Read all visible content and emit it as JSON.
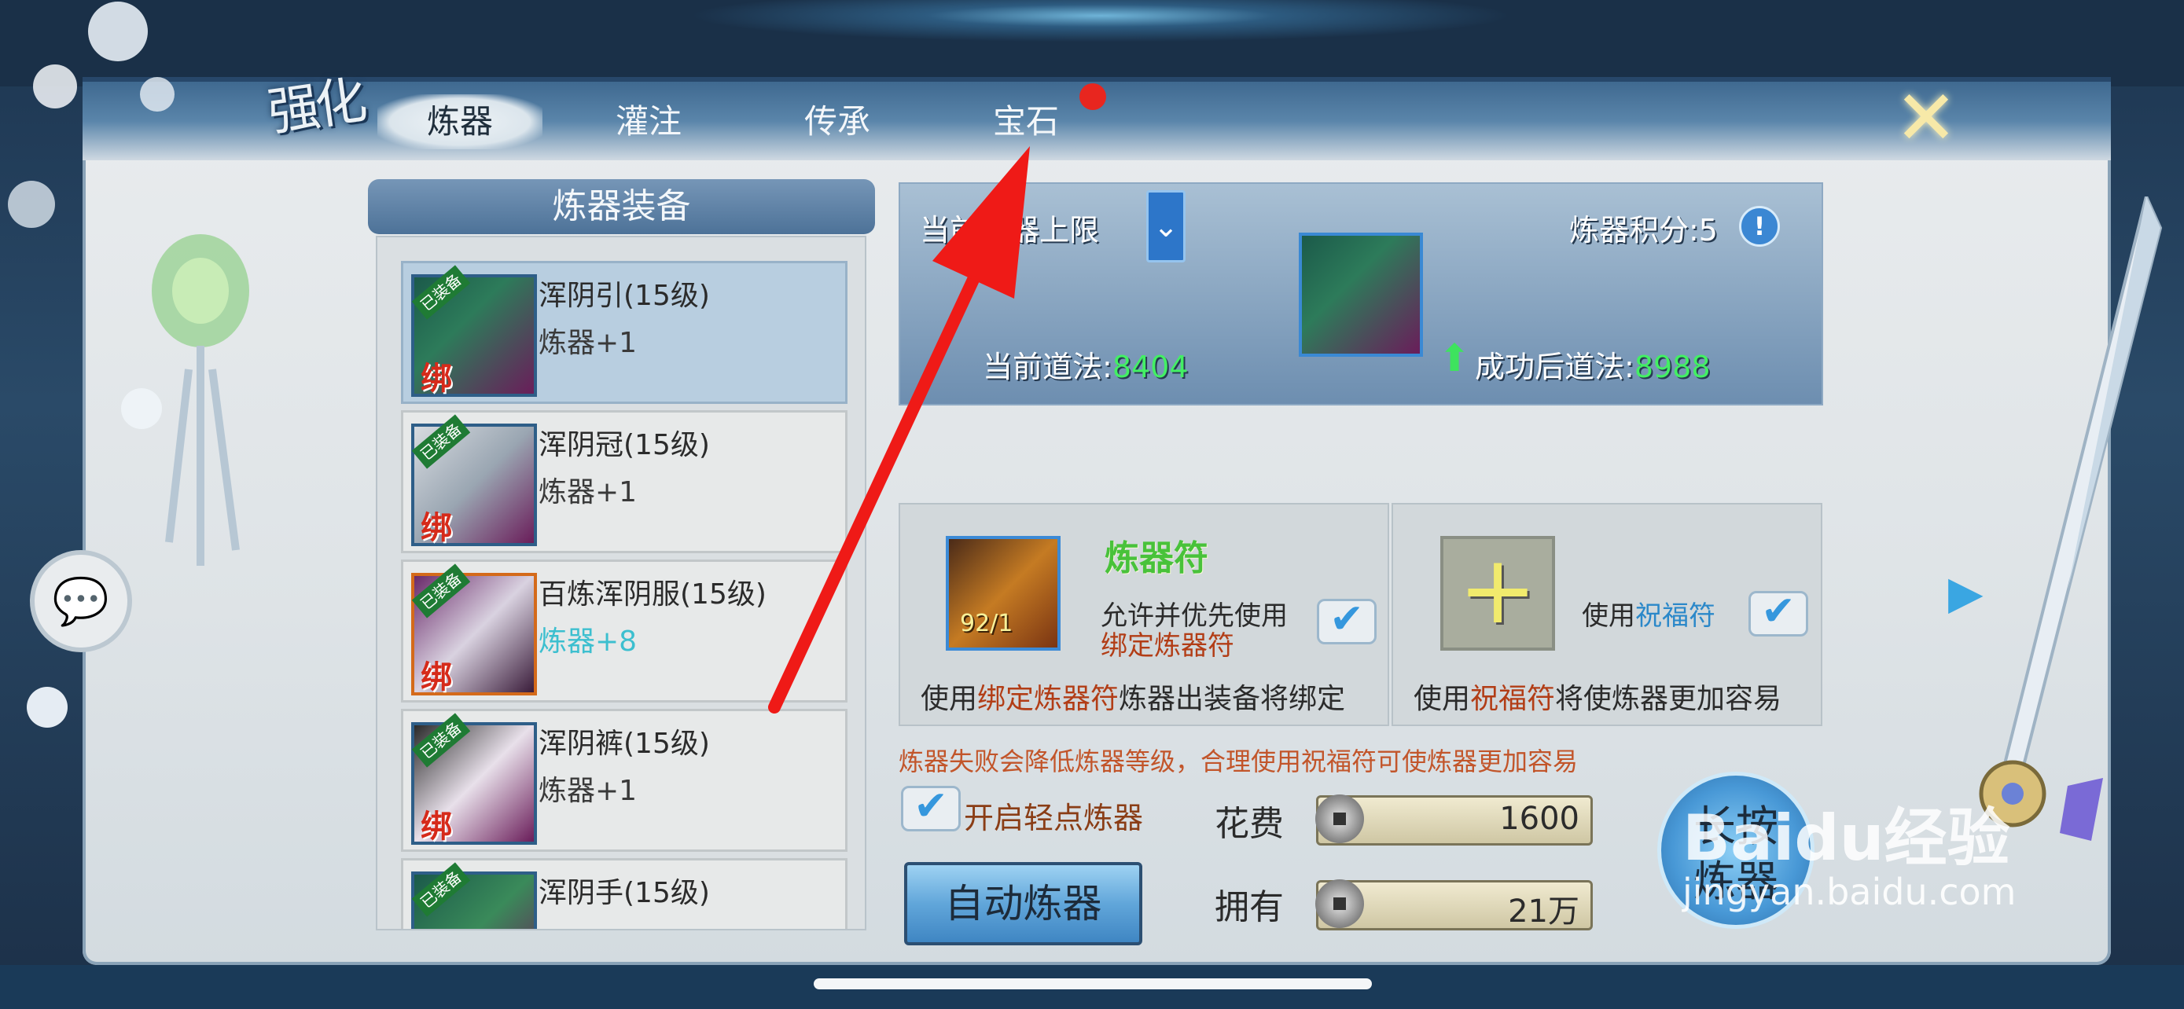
{
  "header": {
    "title_glyph": "强化",
    "tabs": [
      {
        "label": "炼器",
        "active": true
      },
      {
        "label": "灌注",
        "active": false
      },
      {
        "label": "传承",
        "active": false
      },
      {
        "label": "宝石",
        "active": false,
        "has_dot": true
      }
    ],
    "close_icon": "close-cross-icon"
  },
  "equipment_list": {
    "title": "炼器装备",
    "items": [
      {
        "name": "浑阴引(15级)",
        "level": "炼器+1",
        "tag": "已装备",
        "bind": "绑",
        "selected": true
      },
      {
        "name": "浑阴冠(15级)",
        "level": "炼器+1",
        "tag": "已装备",
        "bind": "绑",
        "selected": false
      },
      {
        "name": "百炼浑阴服(15级)",
        "level": "炼器+8",
        "tag": "已装备",
        "bind": "绑",
        "selected": false
      },
      {
        "name": "浑阴裤(15级)",
        "level": "炼器+1",
        "tag": "已装备",
        "bind": "绑",
        "selected": false
      },
      {
        "name": "浑阴手(15级)",
        "level": "",
        "tag": "已装备",
        "bind": "",
        "selected": false
      }
    ]
  },
  "info": {
    "limit_label": "当前炼器上限",
    "score_label": "炼器积分:5",
    "current_label": "当前道法:",
    "current_value": "8404",
    "after_label": "成功后道法:",
    "after_value": "8988"
  },
  "card_left": {
    "title": "炼器符",
    "count": "92/1",
    "option_line1": "允许并优先使用",
    "option_line2": "绑定炼器符",
    "bottom_pre": "使用",
    "bottom_red": "绑定炼器符",
    "bottom_post": "炼器出装备将绑定"
  },
  "card_right": {
    "option_pre": "使用",
    "option_blue": "祝福符",
    "bottom_pre": "使用",
    "bottom_red": "祝福符",
    "bottom_post": "将使炼器更加容易"
  },
  "warning": "炼器失败会降低炼器等级，合理使用祝福符可使炼器更加容易",
  "toggle_label": "开启轻点炼器",
  "cost": {
    "label": "花费",
    "value": "1600"
  },
  "own": {
    "label": "拥有",
    "value": "21万"
  },
  "auto_button": "自动炼器",
  "long_press_line1": "长按",
  "long_press_line2": "炼器",
  "watermark": {
    "brand": "Baidu经验",
    "url": "jingyan.baidu.com"
  }
}
